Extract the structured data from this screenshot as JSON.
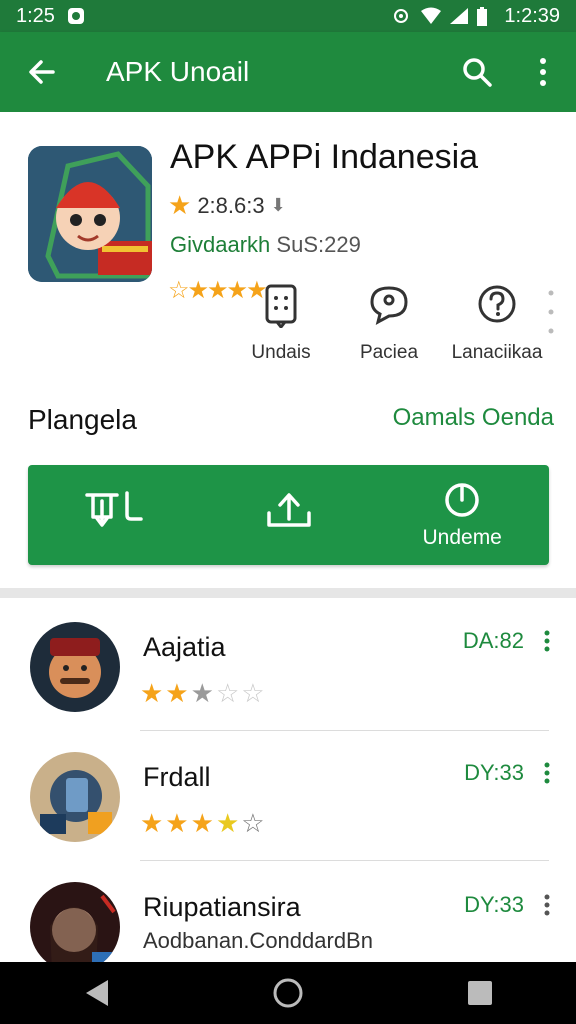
{
  "status": {
    "time_left": "1:25",
    "time_right": "1:2:39"
  },
  "appbar": {
    "title": "APK Unoail"
  },
  "app": {
    "name": "APK APPi Indanesia",
    "rating_text": "2:8.6:3",
    "developer": "Givdaarkh",
    "developer_suffix": "SuS:229",
    "stars": 4
  },
  "features": [
    {
      "label": "Undais",
      "icon": "document-icon"
    },
    {
      "label": "Paciea",
      "icon": "chat-icon"
    },
    {
      "label": "Lanaciikaa",
      "icon": "help-icon"
    }
  ],
  "section": {
    "title": "Plangela",
    "link": "Oamals Oenda"
  },
  "actions": [
    {
      "label": "",
      "icon": "download-icon"
    },
    {
      "label": "",
      "icon": "upload-icon"
    },
    {
      "label": "Undeme",
      "icon": "power-icon"
    }
  ],
  "list": [
    {
      "name": "Aajatia",
      "code": "DA:82",
      "stars": 2.5,
      "subtitle": ""
    },
    {
      "name": "Frdall",
      "code": "DY:33",
      "stars": 4,
      "subtitle": ""
    },
    {
      "name": "Riupatiansira",
      "code": "DY:33",
      "stars": 0,
      "subtitle": "Aodbanan.ConddardBn"
    }
  ],
  "colors": {
    "primary": "#1f8a3e",
    "accent": "#f5a31a"
  }
}
